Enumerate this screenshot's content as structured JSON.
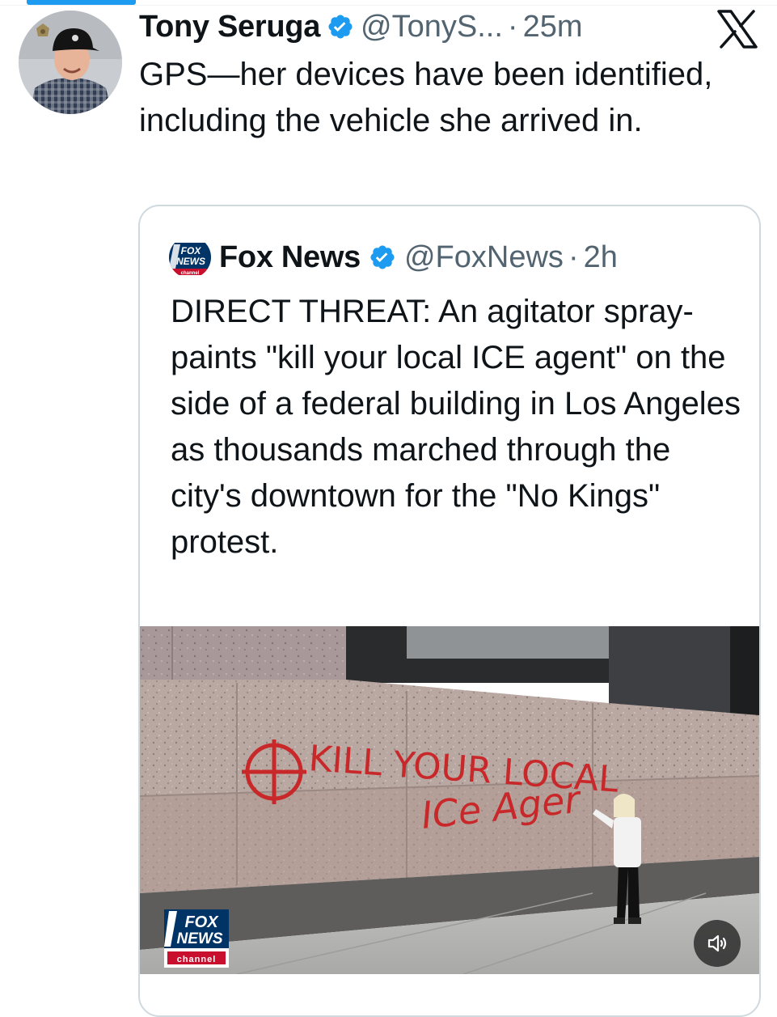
{
  "post": {
    "author_name": "Tony Seruga",
    "handle": "@TonyS...",
    "separator": "·",
    "time": "25m",
    "text": "GPS—her devices have been identified, including the vehicle she arrived in."
  },
  "quote": {
    "author_name": "Fox News",
    "handle": "@FoxNews",
    "separator": "·",
    "time": "2h",
    "text": "DIRECT THREAT: An agitator spray-paints \"kill your local ICE agent\" on the side of a federal building in Los Angeles as thousands marched through the city's downtown for the \"No Kings\" protest.",
    "media": {
      "graffiti_line1": "KILL YOUR LOCAL",
      "graffiti_line2": "ICe Ager",
      "bug_fox": "FOX",
      "bug_news": "NEWS",
      "bug_channel": "channel"
    }
  },
  "logo": {
    "fox_avatar_top": "FOX",
    "fox_avatar_mid": "NEWS",
    "fox_avatar_bottom": "channel"
  },
  "icons": {
    "verified": "verified-badge-icon",
    "platform": "x-logo-icon",
    "sound": "speaker-icon"
  },
  "colors": {
    "accent": "#1d9bf0",
    "text": "#0f1419",
    "muted": "#536471",
    "border": "#cfd9de",
    "graffiti": "#c8282a"
  }
}
